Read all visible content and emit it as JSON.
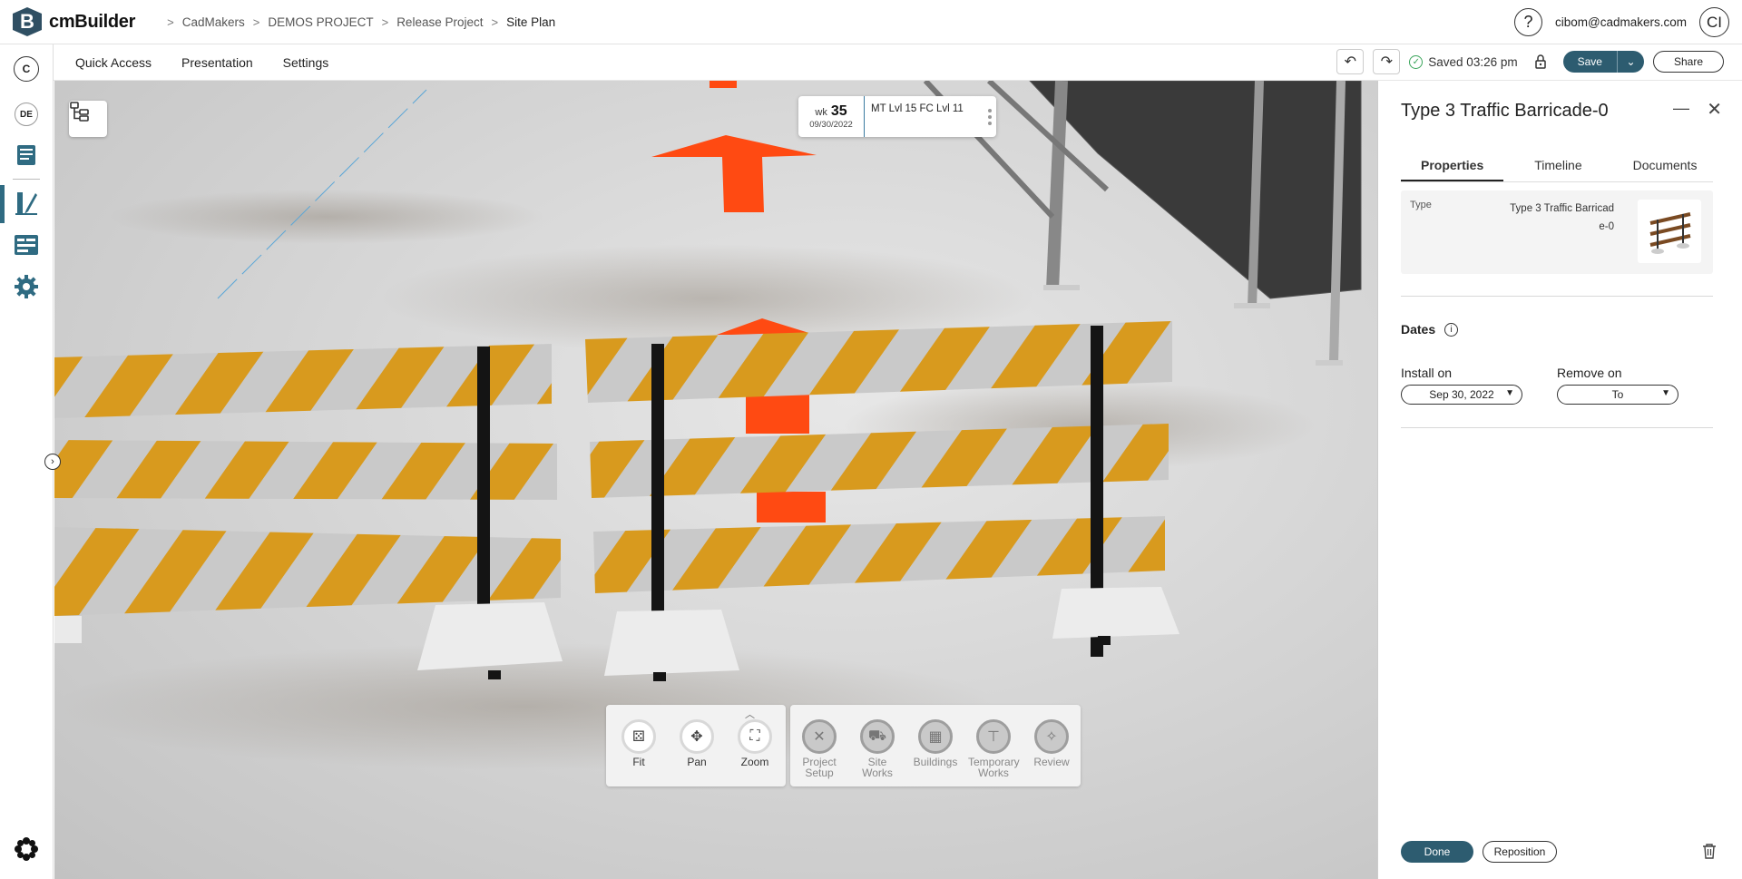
{
  "app": {
    "name": "cmBuilder",
    "logo_letter": "B"
  },
  "breadcrumb": [
    "CadMakers",
    "DEMOS PROJECT",
    "Release Project",
    "Site Plan"
  ],
  "user": {
    "help": "?",
    "email": "cibom@cadmakers.com",
    "initials": "CI"
  },
  "leftrail": {
    "company_badge": "C",
    "project_badge": "DE"
  },
  "toolbar": {
    "menu": [
      "Quick Access",
      "Presentation",
      "Settings"
    ],
    "saved_text": "Saved 03:26 pm",
    "save_label": "Save",
    "share_label": "Share"
  },
  "week_card": {
    "wk_label": "wk",
    "wk_number": "35",
    "date": "09/30/2022",
    "level": "MT Lvl 15 FC Lvl 11"
  },
  "nav_controls": [
    {
      "label": "Fit",
      "icon": "fit-icon"
    },
    {
      "label": "Pan",
      "icon": "pan-icon"
    },
    {
      "label": "Zoom",
      "icon": "zoom-icon"
    }
  ],
  "categories": [
    {
      "label": "Project Setup",
      "icon": "tools-icon"
    },
    {
      "label": "Site Works",
      "icon": "excavator-icon"
    },
    {
      "label": "Buildings",
      "icon": "buildings-icon"
    },
    {
      "label": "Temporary Works",
      "icon": "crane-icon"
    },
    {
      "label": "Review",
      "icon": "review-icon"
    }
  ],
  "panel": {
    "title": "Type 3 Traffic Barricade-0",
    "tabs": [
      "Properties",
      "Timeline",
      "Documents"
    ],
    "active_tab": "Properties",
    "property_key": "Type",
    "property_value": "Type 3 Traffic Barricade-0",
    "dates_title": "Dates",
    "install_label": "Install on",
    "install_value": "Sep 30, 2022",
    "remove_label": "Remove on",
    "remove_value": "To",
    "done_label": "Done",
    "reposition_label": "Reposition"
  },
  "colors": {
    "brand": "#2f4f63",
    "primary_button": "#2d5c70",
    "stripe_orange": "#d89a1e",
    "arrow_orange": "#ff4a12"
  }
}
